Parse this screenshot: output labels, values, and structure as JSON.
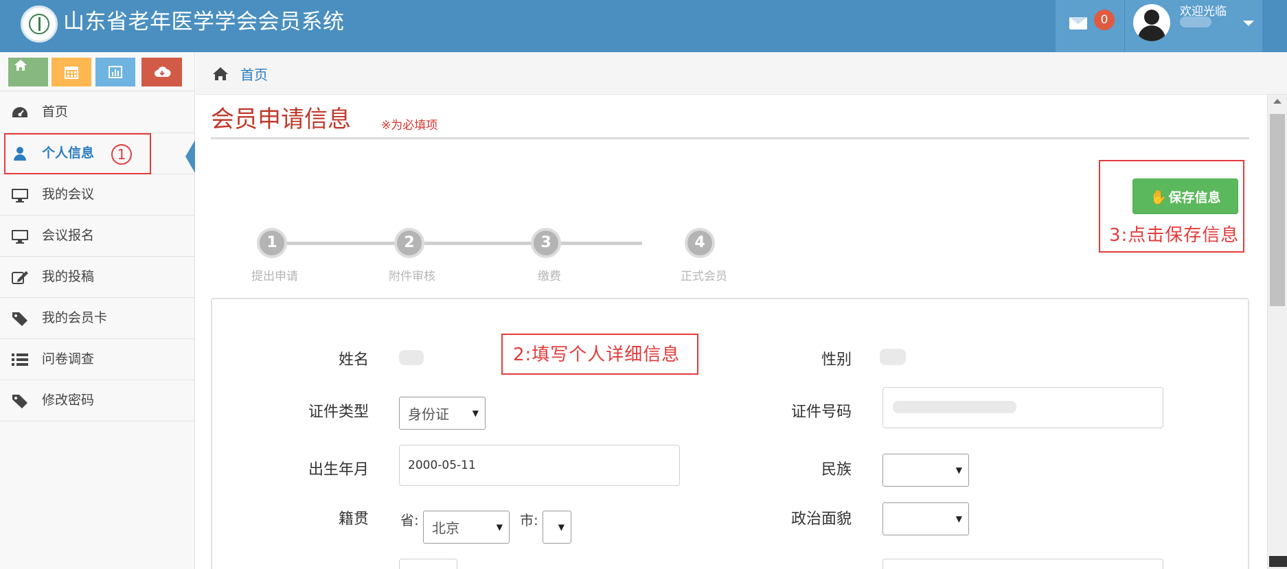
{
  "header": {
    "app_title": "山东省老年医学学会会员系统",
    "mail_count": "0",
    "welcome": "欢迎光临"
  },
  "colors": {
    "header_bg": "#4a8fc0",
    "accent_red": "#e33b3b",
    "title_red": "#c0392b",
    "save_green": "#5cb85c",
    "shortcut_green": "#87b87f",
    "shortcut_orange": "#ffb752",
    "shortcut_blue": "#6fb3e0",
    "shortcut_red": "#d15b47"
  },
  "sidebar": {
    "shortcuts": [
      {
        "icon": "home-icon"
      },
      {
        "icon": "calendar-icon"
      },
      {
        "icon": "bar-chart-icon"
      },
      {
        "icon": "cloud-download-icon"
      }
    ],
    "items": [
      {
        "label": "首页",
        "icon": "dashboard-icon"
      },
      {
        "label": "个人信息",
        "icon": "user-icon",
        "active": true
      },
      {
        "label": "我的会议",
        "icon": "monitor-icon"
      },
      {
        "label": "会议报名",
        "icon": "monitor-icon"
      },
      {
        "label": "我的投稿",
        "icon": "edit-icon"
      },
      {
        "label": "我的会员卡",
        "icon": "tag-icon"
      },
      {
        "label": "问卷调查",
        "icon": "list-icon"
      },
      {
        "label": "修改密码",
        "icon": "tag-icon"
      }
    ]
  },
  "annotations": {
    "step1_marker": "1",
    "step2_hint": "2:填写个人详细信息",
    "step3_hint": "3:点击保存信息"
  },
  "breadcrumb": {
    "label": "首页"
  },
  "form": {
    "title": "会员申请信息",
    "required_note": "※为必填项",
    "save_label": "保存信息",
    "steps": [
      {
        "num": "1",
        "label": "提出申请"
      },
      {
        "num": "2",
        "label": "附件审核"
      },
      {
        "num": "3",
        "label": "缴费"
      },
      {
        "num": "4",
        "label": "正式会员"
      }
    ],
    "fields": {
      "name_label": "姓名",
      "gender_label": "性别",
      "id_type_label": "证件类型",
      "id_type_value": "身份证",
      "id_number_label": "证件号码",
      "birth_label": "出生年月",
      "birth_value": "2000-05-11",
      "ethnicity_label": "民族",
      "hometown_label": "籍贯",
      "province_label": "省:",
      "province_value": "北京",
      "city_label": "市:",
      "politics_label": "政治面貌"
    }
  }
}
